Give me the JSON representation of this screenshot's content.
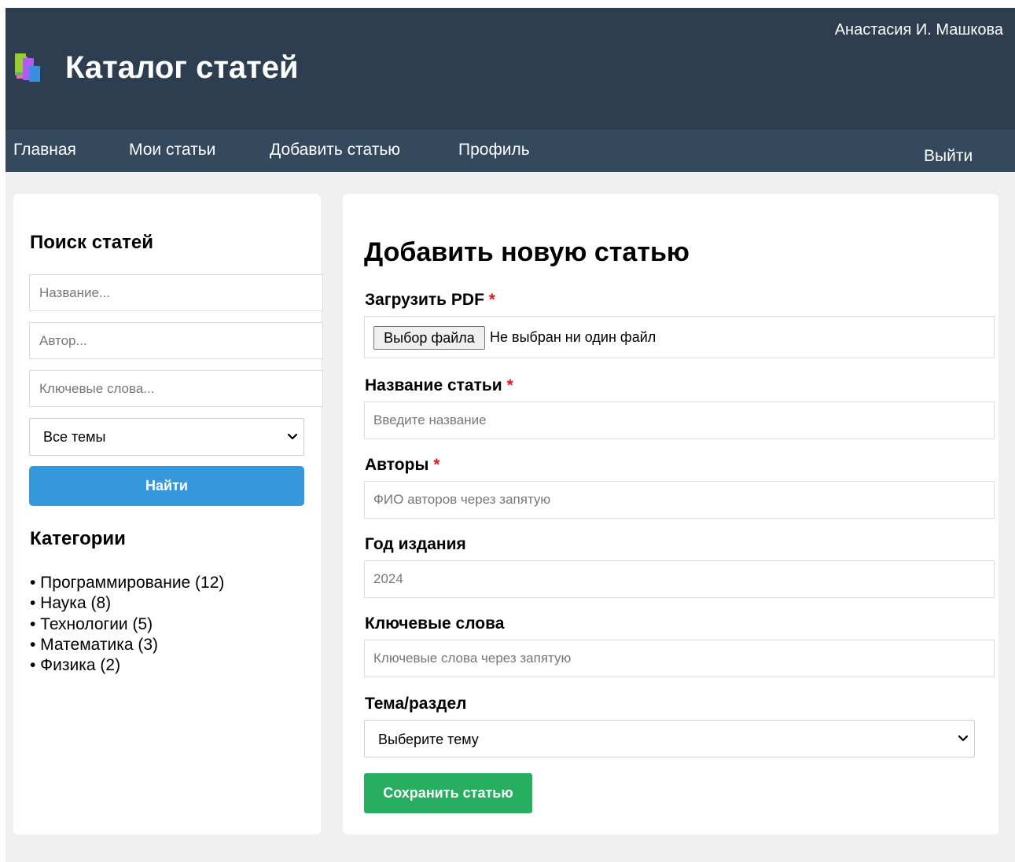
{
  "header": {
    "user_name": "Анастасия И. Машкова",
    "title": "Каталог статей",
    "logo_icon": "books-icon"
  },
  "nav": {
    "items": [
      {
        "label": "Главная"
      },
      {
        "label": "Мои статьи"
      },
      {
        "label": "Добавить статью"
      },
      {
        "label": "Профиль"
      }
    ],
    "logout_label": "Выйти"
  },
  "sidebar": {
    "title": "Поиск статей",
    "title_placeholder": "Название...",
    "author_placeholder": "Автор...",
    "keywords_placeholder": "Ключевые слова...",
    "topic_select_value": "Все темы",
    "search_button": "Найти",
    "categories_title": "Категории",
    "categories": [
      "• Программирование (12)",
      "• Наука (8)",
      "• Технологии (5)",
      "• Математика (3)",
      "• Физика (2)"
    ]
  },
  "form": {
    "heading": "Добавить новую статью",
    "pdf_label": "Загрузить PDF",
    "file_button": "Выбор файла",
    "file_status": "Не выбран ни один файл",
    "title_label": "Название статьи",
    "title_placeholder": "Введите название",
    "authors_label": "Авторы",
    "authors_placeholder": "ФИО авторов через запятую",
    "year_label": "Год издания",
    "year_placeholder": "2024",
    "keywords_label": "Ключевые слова",
    "keywords_placeholder": "Ключевые слова через запятую",
    "topic_label": "Тема/раздел",
    "topic_select_value": "Выберите тему",
    "required_mark": "*",
    "save_button": "Сохранить статью"
  },
  "colors": {
    "header_bg": "#2c3e50",
    "nav_bg": "#34495e",
    "search_button": "#3498db",
    "save_button": "#27ae60",
    "required": "#e01b1b"
  }
}
